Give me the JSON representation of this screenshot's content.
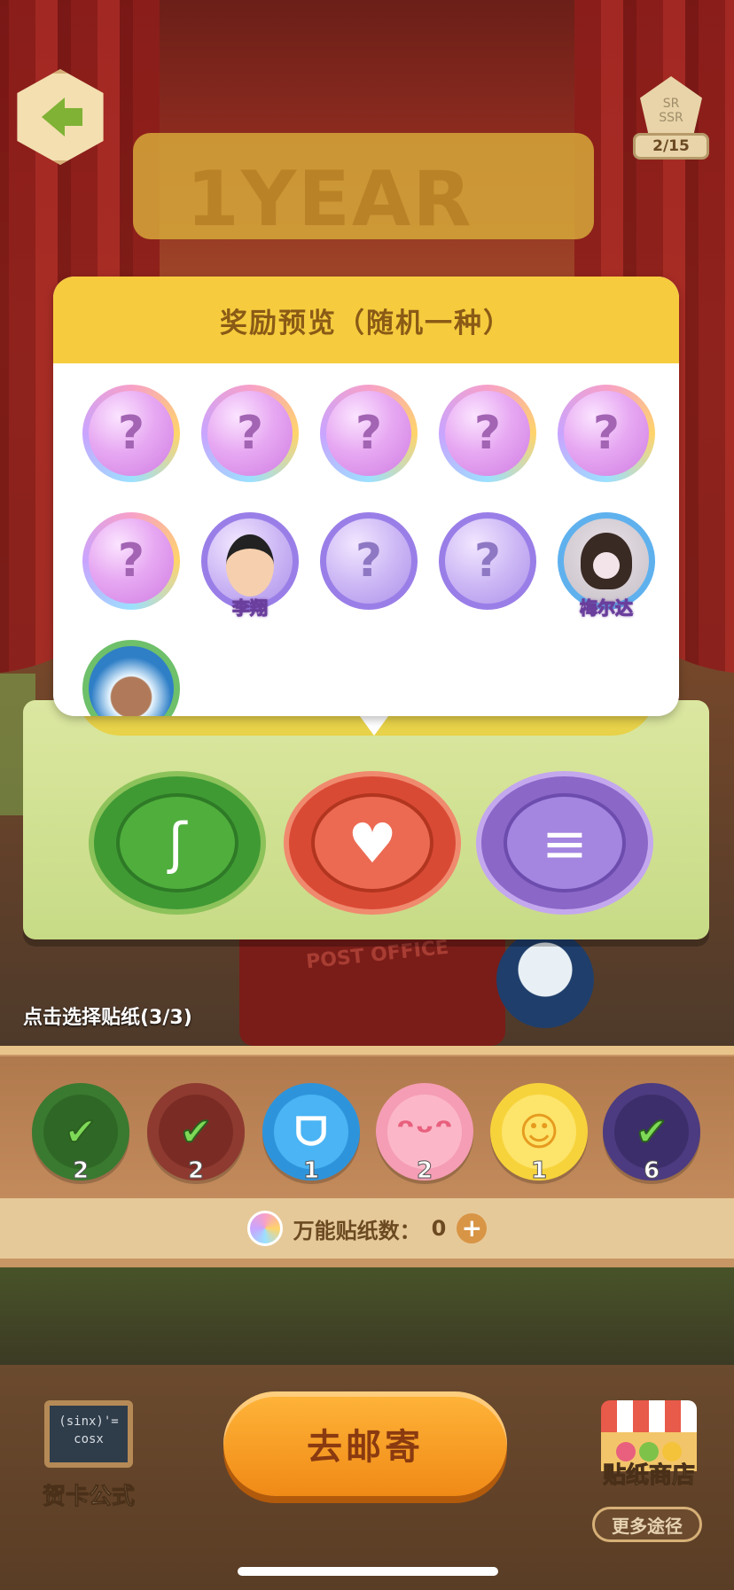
{
  "top": {
    "back_icon": "back-arrow-icon",
    "rarity_lines": [
      "SR",
      "SSR"
    ],
    "rarity_progress": "2/15"
  },
  "background": {
    "banner_text": "1YEAR",
    "postbox_text": "POST OFFICE"
  },
  "popup": {
    "title": "奖励预览（随机一种）",
    "rewards_row1": [
      "?",
      "?",
      "?",
      "?",
      "?"
    ],
    "rewards_row2": [
      {
        "label": "?",
        "name": ""
      },
      {
        "label": "",
        "name": "李翔"
      },
      {
        "label": "?",
        "name": ""
      },
      {
        "label": "?",
        "name": ""
      },
      {
        "label": "",
        "name": "梅尔达"
      }
    ],
    "rewards_row3_count": 1
  },
  "sticker_buttons": {
    "ear": "ear-icon",
    "heart": "hearts-icon",
    "comb": "comb-icon"
  },
  "select_hint": "点击选择贴纸(3/3)",
  "stickers": [
    {
      "name": "ear",
      "count": "2",
      "selected": true,
      "color": "#3a7a30"
    },
    {
      "name": "heart",
      "count": "2",
      "selected": true,
      "color": "#8e3a30"
    },
    {
      "name": "nose",
      "count": "1",
      "selected": false,
      "color": "#2d94dc"
    },
    {
      "name": "face",
      "count": "2",
      "selected": false,
      "color": "#f59db4"
    },
    {
      "name": "smile",
      "count": "1",
      "selected": false,
      "color": "#f7d33b"
    },
    {
      "name": "comb",
      "count": "6",
      "selected": true,
      "color": "#4c3b80"
    }
  ],
  "universal": {
    "label": "万能贴纸数：",
    "count": "0",
    "plus": "+"
  },
  "bottom": {
    "formula_board": "(sinx)'=\ncosx",
    "formula_label": "贺卡公式",
    "mail_button": "去邮寄",
    "shop_label": "贴纸商店",
    "more_ways": "更多途径"
  }
}
